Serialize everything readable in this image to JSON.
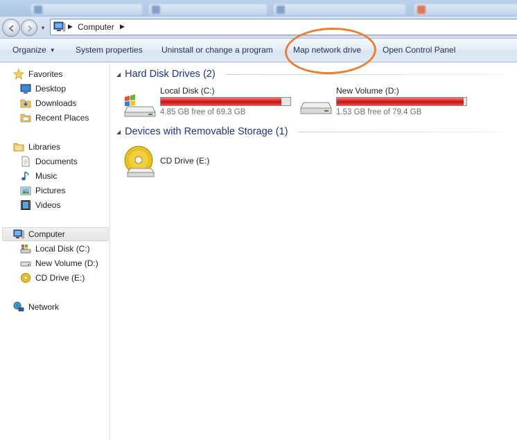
{
  "address": {
    "location": "Computer"
  },
  "commands": {
    "organize": "Organize",
    "system_properties": "System properties",
    "uninstall": "Uninstall or change a program",
    "map_network_drive": "Map network drive",
    "open_control_panel": "Open Control Panel"
  },
  "nav": {
    "favorites": "Favorites",
    "desktop": "Desktop",
    "downloads": "Downloads",
    "recent_places": "Recent Places",
    "libraries": "Libraries",
    "documents": "Documents",
    "music": "Music",
    "pictures": "Pictures",
    "videos": "Videos",
    "computer": "Computer",
    "local_disk": "Local Disk (C:)",
    "new_volume": "New Volume (D:)",
    "cd_drive": "CD Drive (E:)",
    "network": "Network"
  },
  "groups": {
    "hdd_title": "Hard Disk Drives (2)",
    "removable_title": "Devices with Removable Storage (1)"
  },
  "drives": [
    {
      "name": "Local Disk (C:)",
      "free": "4.85 GB free of 69.3 GB",
      "used_fraction": 0.93
    },
    {
      "name": "New Volume (D:)",
      "free": "1.53 GB free of 79.4 GB",
      "used_fraction": 0.98
    }
  ],
  "removable": [
    {
      "name": "CD Drive (E:)"
    }
  ],
  "colors": {
    "highlight": "#ee7d2f",
    "group_title": "#1e3287",
    "usage_bar": "#dd1d1d"
  }
}
